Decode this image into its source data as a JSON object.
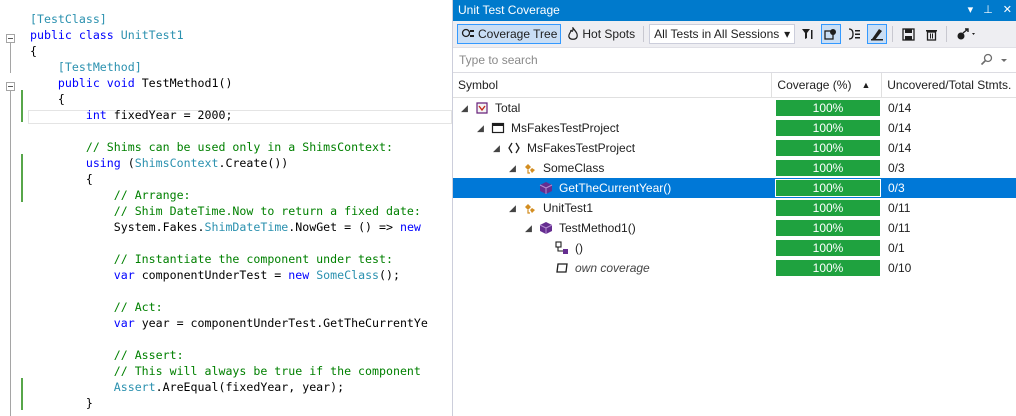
{
  "editor": {
    "lines": [
      [
        [
          "attr",
          "[TestClass]"
        ]
      ],
      [
        [
          "kw",
          "public class "
        ],
        [
          "type",
          "UnitTest1"
        ]
      ],
      [
        [
          "plain",
          "{"
        ]
      ],
      [
        [
          "attr",
          "    [TestMethod]"
        ]
      ],
      [
        [
          "kw",
          "    public void "
        ],
        [
          "plain",
          "TestMethod1()"
        ]
      ],
      [
        [
          "plain",
          "    {"
        ]
      ],
      [
        [
          "kw",
          "        int "
        ],
        [
          "plain",
          "fixedYear = 2000;"
        ]
      ],
      [
        [
          "plain",
          ""
        ]
      ],
      [
        [
          "cm",
          "        // Shims can be used only in a ShimsContext:"
        ]
      ],
      [
        [
          "kw",
          "        using "
        ],
        [
          "plain",
          "("
        ],
        [
          "type",
          "ShimsContext"
        ],
        [
          "plain",
          ".Create())"
        ]
      ],
      [
        [
          "plain",
          "        {"
        ]
      ],
      [
        [
          "cm",
          "            // Arrange:"
        ]
      ],
      [
        [
          "cm",
          "            // Shim DateTime.Now to return a fixed date:"
        ]
      ],
      [
        [
          "plain",
          "            System.Fakes."
        ],
        [
          "type",
          "ShimDateTime"
        ],
        [
          "plain",
          ".NowGet = () => "
        ],
        [
          "kw",
          "new"
        ]
      ],
      [
        [
          "plain",
          ""
        ]
      ],
      [
        [
          "cm",
          "            // Instantiate the component under test:"
        ]
      ],
      [
        [
          "kw",
          "            var "
        ],
        [
          "plain",
          "componentUnderTest = "
        ],
        [
          "kw",
          "new "
        ],
        [
          "type",
          "SomeClass"
        ],
        [
          "plain",
          "();"
        ]
      ],
      [
        [
          "plain",
          ""
        ]
      ],
      [
        [
          "cm",
          "            // Act:"
        ]
      ],
      [
        [
          "kw",
          "            var "
        ],
        [
          "plain",
          "year = componentUnderTest.GetTheCurrentYe"
        ]
      ],
      [
        [
          "plain",
          ""
        ]
      ],
      [
        [
          "cm",
          "            // Assert:"
        ]
      ],
      [
        [
          "cm",
          "            // This will always be true if the component"
        ]
      ],
      [
        [
          "type",
          "            Assert"
        ],
        [
          "plain",
          ".AreEqual(fixedYear, year);"
        ]
      ],
      [
        [
          "plain",
          "        }"
        ]
      ]
    ]
  },
  "panel": {
    "title": "Unit Test Coverage",
    "title_pin": "▾",
    "title_autohide": "⊥",
    "title_close": "✕",
    "toolbar": {
      "coverage_tree_label": "Coverage Tree",
      "hot_spots_label": "Hot Spots",
      "session_selected": "All Tests in All Sessions",
      "dropdown_arrow": "▾"
    },
    "search": {
      "placeholder": "Type to search"
    },
    "columns": {
      "symbol": "Symbol",
      "coverage": "Coverage (%)",
      "stmts": "Uncovered/Total Stmts."
    },
    "rows": [
      {
        "label": "Total",
        "coverage": "100%",
        "stmts": "0/14",
        "twisty": "◢",
        "icon": "solution"
      },
      {
        "label": "MsFakesTestProject",
        "coverage": "100%",
        "stmts": "0/14",
        "twisty": "◢",
        "icon": "project"
      },
      {
        "label": "MsFakesTestProject",
        "coverage": "100%",
        "stmts": "0/14",
        "twisty": "◢",
        "icon": "namespace"
      },
      {
        "label": "SomeClass",
        "coverage": "100%",
        "stmts": "0/3",
        "twisty": "◢",
        "icon": "class"
      },
      {
        "label": "GetTheCurrentYear()",
        "coverage": "100%",
        "stmts": "0/3",
        "twisty": "",
        "icon": "method"
      },
      {
        "label": "UnitTest1",
        "coverage": "100%",
        "stmts": "0/11",
        "twisty": "◢",
        "icon": "class"
      },
      {
        "label": "TestMethod1()",
        "coverage": "100%",
        "stmts": "0/11",
        "twisty": "◢",
        "icon": "method"
      },
      {
        "label": "()",
        "coverage": "100%",
        "stmts": "0/1",
        "twisty": "",
        "icon": "lambda"
      },
      {
        "label": "own coverage",
        "coverage": "100%",
        "stmts": "0/10",
        "twisty": "",
        "icon": "own"
      }
    ]
  },
  "colors": {
    "title_bar": "#007acc",
    "coverage_bar": "#1fa23f",
    "selection": "#0078d7"
  }
}
